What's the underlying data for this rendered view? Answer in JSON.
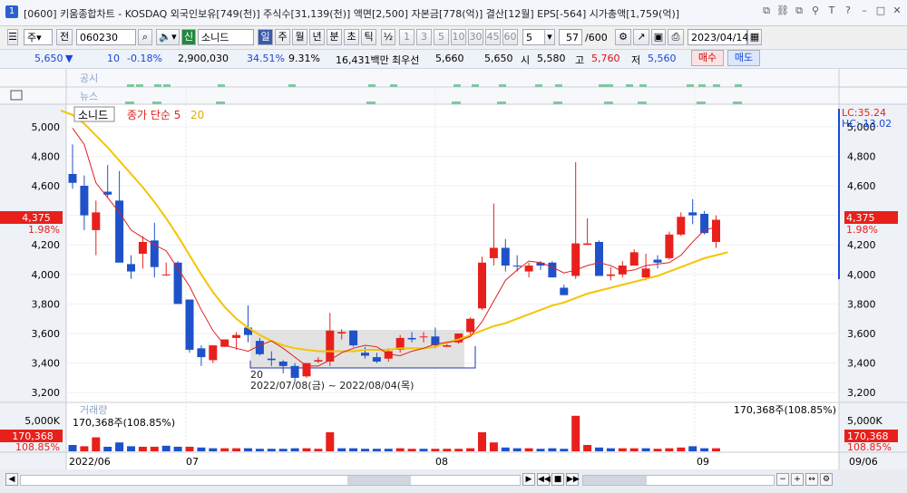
{
  "window": {
    "number": "1",
    "title": "[0600] 키움종합차트 - KOSDAQ 외국인보유[749(천)] 주식수[31,139(천)] 액면[2,500] 자본금[778(억)] 결산[12월] EPS[-564] 시가총액[1,759(억)]"
  },
  "toolbar": {
    "period_select": "주",
    "all_btn": "전",
    "code": "060230",
    "market_badge": "신",
    "stock_name": "소니드",
    "period_buttons": [
      "일",
      "주",
      "월",
      "년",
      "분",
      "초",
      "틱"
    ],
    "active_period": "일",
    "fraction": "½",
    "interval_buttons": [
      "1",
      "3",
      "5",
      "10",
      "30",
      "45",
      "60"
    ],
    "interval_value": "5",
    "count": "57",
    "count_max": "/600",
    "date": "2023/04/14"
  },
  "quote": {
    "price": "5,650",
    "change_arrow": "▼",
    "change": "10",
    "change_pct": "-0.18%",
    "volume": "2,900,030",
    "vol_ratio": "34.51%",
    "turnover": "9.31%",
    "amount": "16,431백만",
    "best_ask_label": "최우선",
    "best_ask": "5,660",
    "best_bid": "5,650",
    "open_label": "시",
    "open": "5,580",
    "high_label": "고",
    "high": "5,760",
    "low_label": "저",
    "low": "5,560",
    "buy_btn": "매수",
    "sell_btn": "매도"
  },
  "panels": {
    "notice_label": "공시",
    "news_label": "뉴스",
    "volume_label": "거래량",
    "volume_value": "170,368주(108.85%)",
    "volume_right": "170,368주(108.85%)"
  },
  "legend": {
    "name": "소니드",
    "ma_label": "종가 단순 5",
    "ma20": "20"
  },
  "price_axis": {
    "ticks": [
      "5,000",
      "4,800",
      "4,600",
      "4,400",
      "4,200",
      "4,000",
      "3,800",
      "3,600",
      "3,400",
      "3,200"
    ],
    "current_price": "4,375",
    "current_pct": "1.98%",
    "lc": "LC:35.24",
    "hc": "HC:-13.02"
  },
  "volume_axis": {
    "tick": "5,000K",
    "current": "170,368",
    "current_pct": "108.85%"
  },
  "date_axis": [
    "2022/06",
    "07",
    "08",
    "09",
    "09/06"
  ],
  "annotation": {
    "count": "20",
    "range": "2022/07/08(금) ~ 2022/08/04(목)"
  },
  "colors": {
    "up": "#e8201c",
    "down": "#1f52c9",
    "ma5": "#e02020",
    "ma20": "#f5c400",
    "highlight_box": "#d8d8d8"
  },
  "chart_data": {
    "type": "candlestick",
    "ylim": [
      3140,
      5140
    ],
    "candles": [
      {
        "o": 4620,
        "h": 4880,
        "l": 4580,
        "c": 4680,
        "dir": "down"
      },
      {
        "o": 4600,
        "h": 4670,
        "l": 4300,
        "c": 4400,
        "dir": "down"
      },
      {
        "o": 4300,
        "h": 4500,
        "l": 4130,
        "c": 4420,
        "dir": "up"
      },
      {
        "o": 4560,
        "h": 4740,
        "l": 4520,
        "c": 4540,
        "dir": "down"
      },
      {
        "o": 4500,
        "h": 4700,
        "l": 4100,
        "c": 4080,
        "dir": "down"
      },
      {
        "o": 4070,
        "h": 4130,
        "l": 3970,
        "c": 4020,
        "dir": "down"
      },
      {
        "o": 4140,
        "h": 4260,
        "l": 4040,
        "c": 4220,
        "dir": "up"
      },
      {
        "o": 4230,
        "h": 4350,
        "l": 3980,
        "c": 4050,
        "dir": "down"
      },
      {
        "o": 4000,
        "h": 4080,
        "l": 3990,
        "c": 4000,
        "dir": "up"
      },
      {
        "o": 4080,
        "h": 4090,
        "l": 3820,
        "c": 3800,
        "dir": "down"
      },
      {
        "o": 3830,
        "h": 3830,
        "l": 3470,
        "c": 3490,
        "dir": "down"
      },
      {
        "o": 3500,
        "h": 3520,
        "l": 3380,
        "c": 3440,
        "dir": "down"
      },
      {
        "o": 3420,
        "h": 3490,
        "l": 3400,
        "c": 3520,
        "dir": "up"
      },
      {
        "o": 3510,
        "h": 3560,
        "l": 3510,
        "c": 3560,
        "dir": "up"
      },
      {
        "o": 3570,
        "h": 3610,
        "l": 3490,
        "c": 3590,
        "dir": "up"
      },
      {
        "o": 3590,
        "h": 3790,
        "l": 3540,
        "c": 3640,
        "dir": "down"
      },
      {
        "o": 3550,
        "h": 3570,
        "l": 3450,
        "c": 3460,
        "dir": "down"
      },
      {
        "o": 3430,
        "h": 3480,
        "l": 3380,
        "c": 3420,
        "dir": "down"
      },
      {
        "o": 3410,
        "h": 3420,
        "l": 3330,
        "c": 3380,
        "dir": "down"
      },
      {
        "o": 3380,
        "h": 3400,
        "l": 3270,
        "c": 3300,
        "dir": "down"
      },
      {
        "o": 3310,
        "h": 3380,
        "l": 3300,
        "c": 3400,
        "dir": "up"
      },
      {
        "o": 3420,
        "h": 3440,
        "l": 3400,
        "c": 3410,
        "dir": "up"
      },
      {
        "o": 3410,
        "h": 3740,
        "l": 3380,
        "c": 3620,
        "dir": "up"
      },
      {
        "o": 3600,
        "h": 3630,
        "l": 3560,
        "c": 3610,
        "dir": "up"
      },
      {
        "o": 3620,
        "h": 3620,
        "l": 3510,
        "c": 3520,
        "dir": "down"
      },
      {
        "o": 3470,
        "h": 3510,
        "l": 3430,
        "c": 3450,
        "dir": "down"
      },
      {
        "o": 3440,
        "h": 3470,
        "l": 3400,
        "c": 3410,
        "dir": "down"
      },
      {
        "o": 3430,
        "h": 3500,
        "l": 3410,
        "c": 3480,
        "dir": "up"
      },
      {
        "o": 3490,
        "h": 3590,
        "l": 3470,
        "c": 3570,
        "dir": "up"
      },
      {
        "o": 3570,
        "h": 3610,
        "l": 3540,
        "c": 3560,
        "dir": "down"
      },
      {
        "o": 3580,
        "h": 3610,
        "l": 3540,
        "c": 3580,
        "dir": "up"
      },
      {
        "o": 3580,
        "h": 3640,
        "l": 3500,
        "c": 3520,
        "dir": "down"
      },
      {
        "o": 3510,
        "h": 3530,
        "l": 3510,
        "c": 3520,
        "dir": "up"
      },
      {
        "o": 3540,
        "h": 3600,
        "l": 3530,
        "c": 3600,
        "dir": "up"
      },
      {
        "o": 3610,
        "h": 3710,
        "l": 3590,
        "c": 3700,
        "dir": "up"
      },
      {
        "o": 3770,
        "h": 4120,
        "l": 3760,
        "c": 4080,
        "dir": "up"
      },
      {
        "o": 4110,
        "h": 4480,
        "l": 4060,
        "c": 4180,
        "dir": "up"
      },
      {
        "o": 4180,
        "h": 4240,
        "l": 4020,
        "c": 4060,
        "dir": "down"
      },
      {
        "o": 4060,
        "h": 4130,
        "l": 4020,
        "c": 4060,
        "dir": "down"
      },
      {
        "o": 4020,
        "h": 4080,
        "l": 3980,
        "c": 4060,
        "dir": "up"
      },
      {
        "o": 4080,
        "h": 4090,
        "l": 4030,
        "c": 4060,
        "dir": "down"
      },
      {
        "o": 4080,
        "h": 4090,
        "l": 3980,
        "c": 3980,
        "dir": "down"
      },
      {
        "o": 3910,
        "h": 3930,
        "l": 3860,
        "c": 3860,
        "dir": "down"
      },
      {
        "o": 3990,
        "h": 4760,
        "l": 3970,
        "c": 4210,
        "dir": "up"
      },
      {
        "o": 4200,
        "h": 4380,
        "l": 4200,
        "c": 4210,
        "dir": "up"
      },
      {
        "o": 4220,
        "h": 4230,
        "l": 3990,
        "c": 3990,
        "dir": "down"
      },
      {
        "o": 3990,
        "h": 4050,
        "l": 3960,
        "c": 4000,
        "dir": "up"
      },
      {
        "o": 4000,
        "h": 4090,
        "l": 3980,
        "c": 4060,
        "dir": "up"
      },
      {
        "o": 4060,
        "h": 4170,
        "l": 4060,
        "c": 4150,
        "dir": "up"
      },
      {
        "o": 4040,
        "h": 4140,
        "l": 3960,
        "c": 3980,
        "dir": "up"
      },
      {
        "o": 4080,
        "h": 4130,
        "l": 4040,
        "c": 4100,
        "dir": "down"
      },
      {
        "o": 4110,
        "h": 4290,
        "l": 4100,
        "c": 4270,
        "dir": "up"
      },
      {
        "o": 4270,
        "h": 4420,
        "l": 4260,
        "c": 4390,
        "dir": "up"
      },
      {
        "o": 4400,
        "h": 4510,
        "l": 4340,
        "c": 4420,
        "dir": "down"
      },
      {
        "o": 4410,
        "h": 4430,
        "l": 4270,
        "c": 4280,
        "dir": "down"
      },
      {
        "o": 4370,
        "h": 4400,
        "l": 4180,
        "c": 4220,
        "dir": "up"
      }
    ],
    "ma5": [
      4990,
      4880,
      4620,
      4520,
      4420,
      4300,
      4250,
      4200,
      4160,
      4040,
      3920,
      3760,
      3620,
      3520,
      3500,
      3480,
      3520,
      3550,
      3500,
      3440,
      3380,
      3380,
      3420,
      3470,
      3500,
      3520,
      3510,
      3460,
      3450,
      3480,
      3500,
      3530,
      3540,
      3550,
      3580,
      3680,
      3820,
      3960,
      4030,
      4090,
      4080,
      4050,
      4010,
      4030,
      4060,
      4080,
      4060,
      4020,
      4030,
      4060,
      4070,
      4080,
      4130,
      4220,
      4300,
      4320
    ],
    "ma20": [
      5110,
      5080,
      5020,
      4940,
      4860,
      4770,
      4680,
      4590,
      4490,
      4380,
      4260,
      4130,
      4000,
      3880,
      3780,
      3700,
      3640,
      3590,
      3550,
      3520,
      3500,
      3490,
      3480,
      3480,
      3480,
      3480,
      3490,
      3490,
      3490,
      3500,
      3500,
      3500,
      3510,
      3540,
      3560,
      3590,
      3620,
      3650,
      3670,
      3700,
      3730,
      3760,
      3790,
      3810,
      3840,
      3870,
      3890,
      3910,
      3930,
      3950,
      3970,
      3990,
      4020,
      4050,
      4080,
      4110,
      4130,
      4150
    ],
    "volume": [
      {
        "v": 0.25,
        "dir": "down"
      },
      {
        "v": 0.2,
        "dir": "up"
      },
      {
        "v": 0.55,
        "dir": "up"
      },
      {
        "v": 0.18,
        "dir": "down"
      },
      {
        "v": 0.35,
        "dir": "down"
      },
      {
        "v": 0.2,
        "dir": "down"
      },
      {
        "v": 0.18,
        "dir": "up"
      },
      {
        "v": 0.18,
        "dir": "up"
      },
      {
        "v": 0.22,
        "dir": "down"
      },
      {
        "v": 0.18,
        "dir": "down"
      },
      {
        "v": 0.18,
        "dir": "up"
      },
      {
        "v": 0.15,
        "dir": "down"
      },
      {
        "v": 0.12,
        "dir": "down"
      },
      {
        "v": 0.12,
        "dir": "up"
      },
      {
        "v": 0.12,
        "dir": "up"
      },
      {
        "v": 0.12,
        "dir": "down"
      },
      {
        "v": 0.1,
        "dir": "down"
      },
      {
        "v": 0.1,
        "dir": "down"
      },
      {
        "v": 0.1,
        "dir": "down"
      },
      {
        "v": 0.12,
        "dir": "down"
      },
      {
        "v": 0.12,
        "dir": "up"
      },
      {
        "v": 0.1,
        "dir": "up"
      },
      {
        "v": 0.75,
        "dir": "up"
      },
      {
        "v": 0.12,
        "dir": "down"
      },
      {
        "v": 0.12,
        "dir": "down"
      },
      {
        "v": 0.1,
        "dir": "down"
      },
      {
        "v": 0.1,
        "dir": "down"
      },
      {
        "v": 0.1,
        "dir": "down"
      },
      {
        "v": 0.12,
        "dir": "up"
      },
      {
        "v": 0.1,
        "dir": "up"
      },
      {
        "v": 0.1,
        "dir": "down"
      },
      {
        "v": 0.1,
        "dir": "up"
      },
      {
        "v": 0.1,
        "dir": "up"
      },
      {
        "v": 0.1,
        "dir": "up"
      },
      {
        "v": 0.12,
        "dir": "up"
      },
      {
        "v": 0.75,
        "dir": "up"
      },
      {
        "v": 0.35,
        "dir": "up"
      },
      {
        "v": 0.15,
        "dir": "down"
      },
      {
        "v": 0.12,
        "dir": "down"
      },
      {
        "v": 0.12,
        "dir": "up"
      },
      {
        "v": 0.1,
        "dir": "down"
      },
      {
        "v": 0.12,
        "dir": "down"
      },
      {
        "v": 0.1,
        "dir": "down"
      },
      {
        "v": 1.4,
        "dir": "up"
      },
      {
        "v": 0.25,
        "dir": "up"
      },
      {
        "v": 0.15,
        "dir": "down"
      },
      {
        "v": 0.12,
        "dir": "down"
      },
      {
        "v": 0.12,
        "dir": "up"
      },
      {
        "v": 0.12,
        "dir": "up"
      },
      {
        "v": 0.12,
        "dir": "down"
      },
      {
        "v": 0.1,
        "dir": "up"
      },
      {
        "v": 0.12,
        "dir": "up"
      },
      {
        "v": 0.15,
        "dir": "up"
      },
      {
        "v": 0.2,
        "dir": "down"
      },
      {
        "v": 0.12,
        "dir": "down"
      },
      {
        "v": 0.12,
        "dir": "up"
      }
    ]
  }
}
